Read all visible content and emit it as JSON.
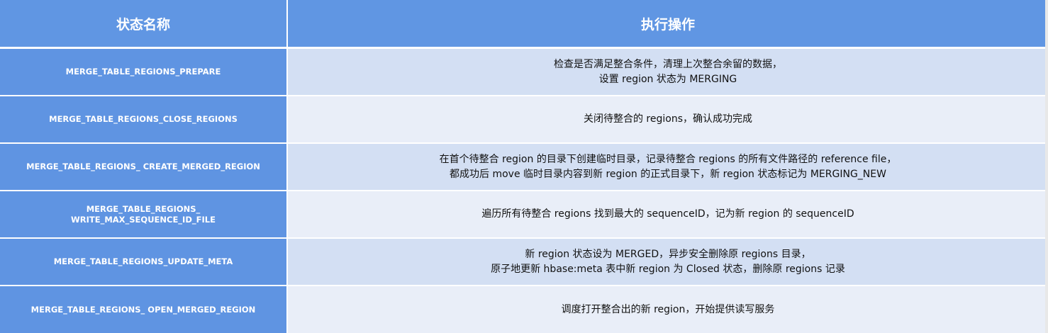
{
  "header": {
    "col1": "状态名称",
    "col2": "执行操作"
  },
  "rows": [
    {
      "state": [
        "MERGE_TABLE_REGIONS_PREPARE"
      ],
      "action": [
        "检查是否满足整合条件，清理上次整合余留的数据，",
        "设置 region 状态为 MERGING"
      ]
    },
    {
      "state": [
        "MERGE_TABLE_REGIONS_CLOSE_REGIONS"
      ],
      "action": [
        "关闭待整合的 regions，确认成功完成"
      ]
    },
    {
      "state": [
        "MERGE_TABLE_REGIONS_ CREATE_MERGED_REGION"
      ],
      "action": [
        "在首个待整合 region 的目录下创建临时目录，记录待整合 regions 的所有文件路径的 reference file，",
        "都成功后 move 临时目录内容到新 region 的正式目录下，新 region 状态标记为 MERGING_NEW"
      ]
    },
    {
      "state": [
        "MERGE_TABLE_REGIONS_",
        "WRITE_MAX_SEQUENCE_ID_FILE"
      ],
      "action": [
        "遍历所有待整合 regions 找到最大的 sequenceID，记为新 region 的 sequenceID"
      ]
    },
    {
      "state": [
        "MERGE_TABLE_REGIONS_UPDATE_META"
      ],
      "action": [
        "新 region 状态设为 MERGED，异步安全删除原 regions 目录，",
        "原子地更新 hbase:meta 表中新 region 为 Closed 状态，删除原 regions 记录"
      ]
    },
    {
      "state": [
        "MERGE_TABLE_REGIONS_ OPEN_MERGED_REGION"
      ],
      "action": [
        "调度打开整合出的新 region，开始提供读写服务"
      ]
    }
  ]
}
